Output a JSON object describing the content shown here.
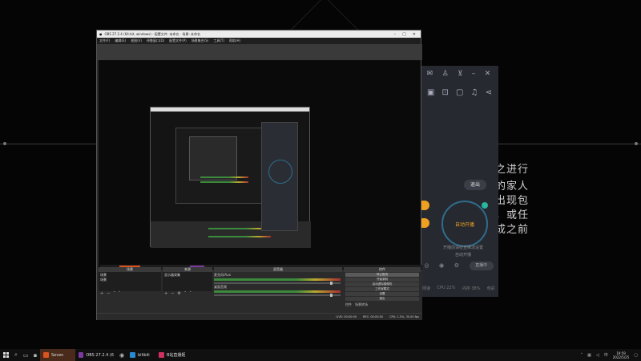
{
  "colors": {
    "accent": "#f0a020",
    "ring": "#2f6d8c",
    "obs_bg": "#2b2b2b",
    "taskbar": "#101010"
  },
  "obs": {
    "title": "OBS 27.2.4 (64-bit, windows) - 配置文件: 未命名 - 场景: 未命名",
    "menu": [
      "文件(F)",
      "编辑(E)",
      "视图(V)",
      "停靠窗口(D)",
      "配置文件(P)",
      "场景集合(S)",
      "工具(T)",
      "帮助(H)"
    ],
    "scene_header_label": "源无选择",
    "props_label": "属性",
    "filters_label": "滤镜",
    "docks": {
      "scenes_title": "场景",
      "scenes_items": [
        "场景",
        "场景"
      ],
      "sources_title": "来源",
      "sources_items": [
        "显示器采集"
      ],
      "mixer_title": "混音器",
      "mixer_rows": [
        {
          "name": "麦克风/Aux",
          "db": "0.0 dB"
        },
        {
          "name": "桌面音频",
          "db": "-4.4 dB"
        }
      ],
      "controls_title": "控件",
      "controls": [
        "停止推流",
        "开始录制",
        "启动虚拟摄像机",
        "工作室模式",
        "设置",
        "退出"
      ],
      "controls_footer": [
        "控件",
        "场景转场"
      ]
    },
    "status": {
      "live": "LIVE: 00:00:00",
      "rec": "REC: 00:00:00",
      "cpu": "CPU: 1.5%, 30.00 fps"
    }
  },
  "right_app": {
    "exit_label": "退出",
    "ring_label": "自动开播",
    "tip_line1": "开播前请检查推流设置",
    "tip_line2": "自动开播",
    "bottom_pill": "直播中",
    "stats": [
      "网速",
      "CPU 22%",
      "内存 38%",
      "色彩"
    ]
  },
  "desktop_text": {
    "line1": "之进行",
    "line2": "的家人",
    "line3": "出现包",
    "line4": "，或任",
    "line5": "成之前"
  },
  "taskbar": {
    "items": [
      {
        "label": "Seven",
        "color": "#d9541e"
      },
      {
        "label": "OBS 27.2.4 (64-bit)...",
        "color": "#7a3aa0"
      },
      {
        "label": "bilibili",
        "color": "#2a8ad0"
      },
      {
        "label": "B站直播姬",
        "color": "#d03060"
      }
    ],
    "time": "19:59",
    "date": "2022/5/25"
  }
}
